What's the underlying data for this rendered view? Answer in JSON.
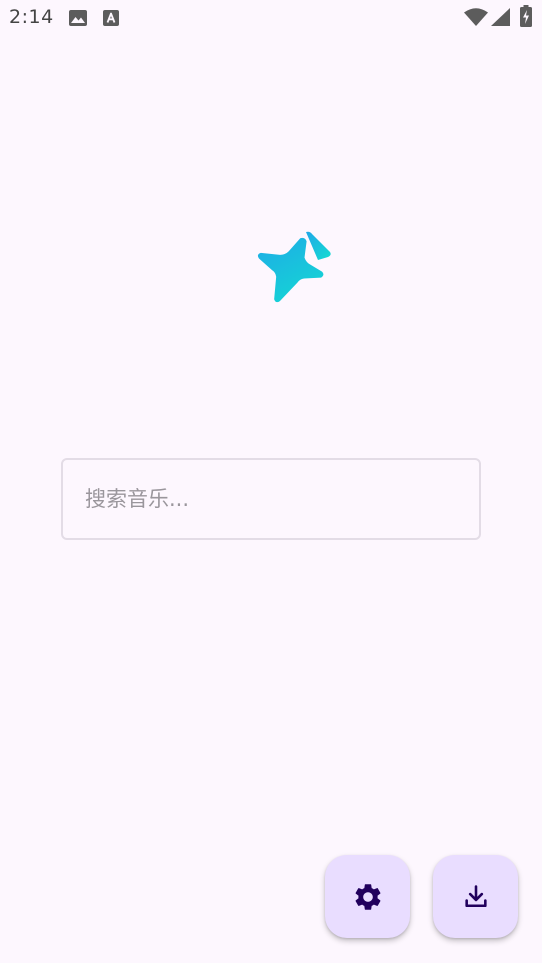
{
  "status_bar": {
    "time": "2:14",
    "icons": [
      "image-icon",
      "font-a-icon",
      "wifi-icon",
      "signal-icon",
      "battery-charging-icon"
    ]
  },
  "app": {
    "logo_icon": "sparkle-star-logo",
    "logo_gradient": [
      "#1fa8e8",
      "#13dcd1"
    ]
  },
  "search": {
    "placeholder": "搜索音乐...",
    "value": ""
  },
  "actions": {
    "settings_icon": "gear-icon",
    "download_icon": "download-icon",
    "fab_color": "#e9ddff",
    "icon_color": "#21005d"
  },
  "colors": {
    "background": "#fdf7fe",
    "input_border": "#e3dce6"
  }
}
